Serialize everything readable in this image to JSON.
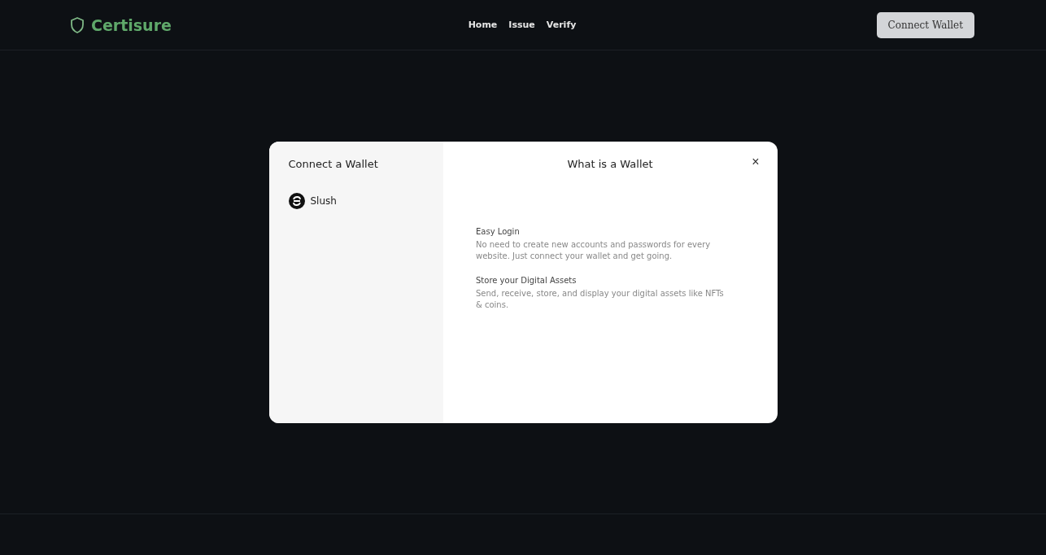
{
  "header": {
    "brand": "Certisure",
    "nav": [
      "Home",
      "Issue",
      "Verify"
    ],
    "connect_button": "Connect Wallet"
  },
  "modal": {
    "sidebar": {
      "title": "Connect a Wallet",
      "wallets": [
        {
          "name": "Slush"
        }
      ]
    },
    "panel": {
      "title": "What is a Wallet",
      "close": "×",
      "features": [
        {
          "title": "Easy Login",
          "description": "No need to create new accounts and passwords for every website. Just connect your wallet and get going."
        },
        {
          "title": "Store your Digital Assets",
          "description": "Send, receive, store, and display your digital assets like NFTs & coins."
        }
      ]
    }
  }
}
